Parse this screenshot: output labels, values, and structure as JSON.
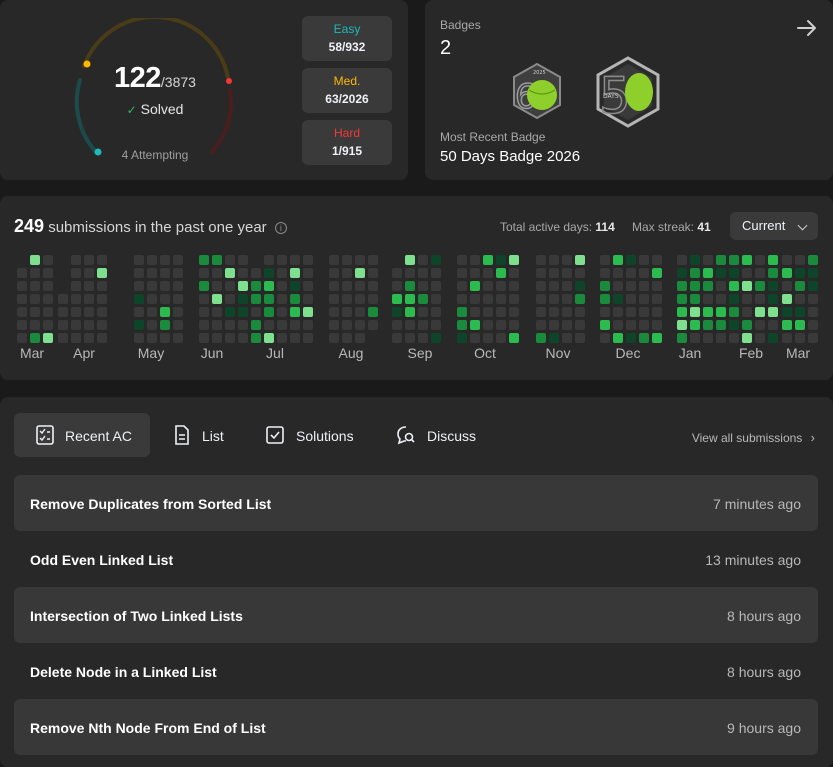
{
  "progress": {
    "solved": "122",
    "total": "/3873",
    "solved_label": "Solved",
    "attempting": "4 Attempting",
    "difficulties": [
      {
        "name": "Easy",
        "value": "58/932",
        "color": "#1cbaba"
      },
      {
        "name": "Med.",
        "value": "63/2026",
        "color": "#ffb700"
      },
      {
        "name": "Hard",
        "value": "1/915",
        "color": "#f63737"
      }
    ]
  },
  "badges": {
    "label": "Badges",
    "count": "2",
    "recent_label": "Most Recent Badge",
    "recent_name": "50 Days Badge 2026",
    "items": [
      {
        "icon": "annual-badge-icon",
        "label": "2025"
      },
      {
        "icon": "50-days-badge-icon",
        "label": "DAYS"
      }
    ]
  },
  "calendar": {
    "count": "249",
    "title_suffix": "submissions in the past one year",
    "active_days_label": "Total active days:",
    "active_days": "114",
    "max_streak_label": "Max streak:",
    "max_streak": "41",
    "select_value": "Current",
    "months": [
      "Mar",
      "Apr",
      "May",
      "Jun",
      "Jul",
      "Aug",
      "Sep",
      "Oct",
      "Nov",
      "Dec",
      "Jan",
      "Feb",
      "Mar"
    ],
    "colors": {
      "empty": "#393939",
      "l1": "#0e4429",
      "l2": "#1a8a3c",
      "l3": "#2bbb4f",
      "l4": "#7ee08e"
    }
  },
  "recent": {
    "tabs": [
      {
        "label": "Recent AC",
        "icon": "checklist-icon"
      },
      {
        "label": "List",
        "icon": "document-icon"
      },
      {
        "label": "Solutions",
        "icon": "checkbox-icon"
      },
      {
        "label": "Discuss",
        "icon": "discuss-icon"
      }
    ],
    "view_all": "View all submissions",
    "items": [
      {
        "title": "Remove Duplicates from Sorted List",
        "time": "7 minutes ago"
      },
      {
        "title": "Odd Even Linked List",
        "time": "13 minutes ago"
      },
      {
        "title": "Intersection of Two Linked Lists",
        "time": "8 hours ago"
      },
      {
        "title": "Delete Node in a Linked List",
        "time": "8 hours ago"
      },
      {
        "title": "Remove Nth Node From End of List",
        "time": "9 hours ago"
      }
    ]
  }
}
